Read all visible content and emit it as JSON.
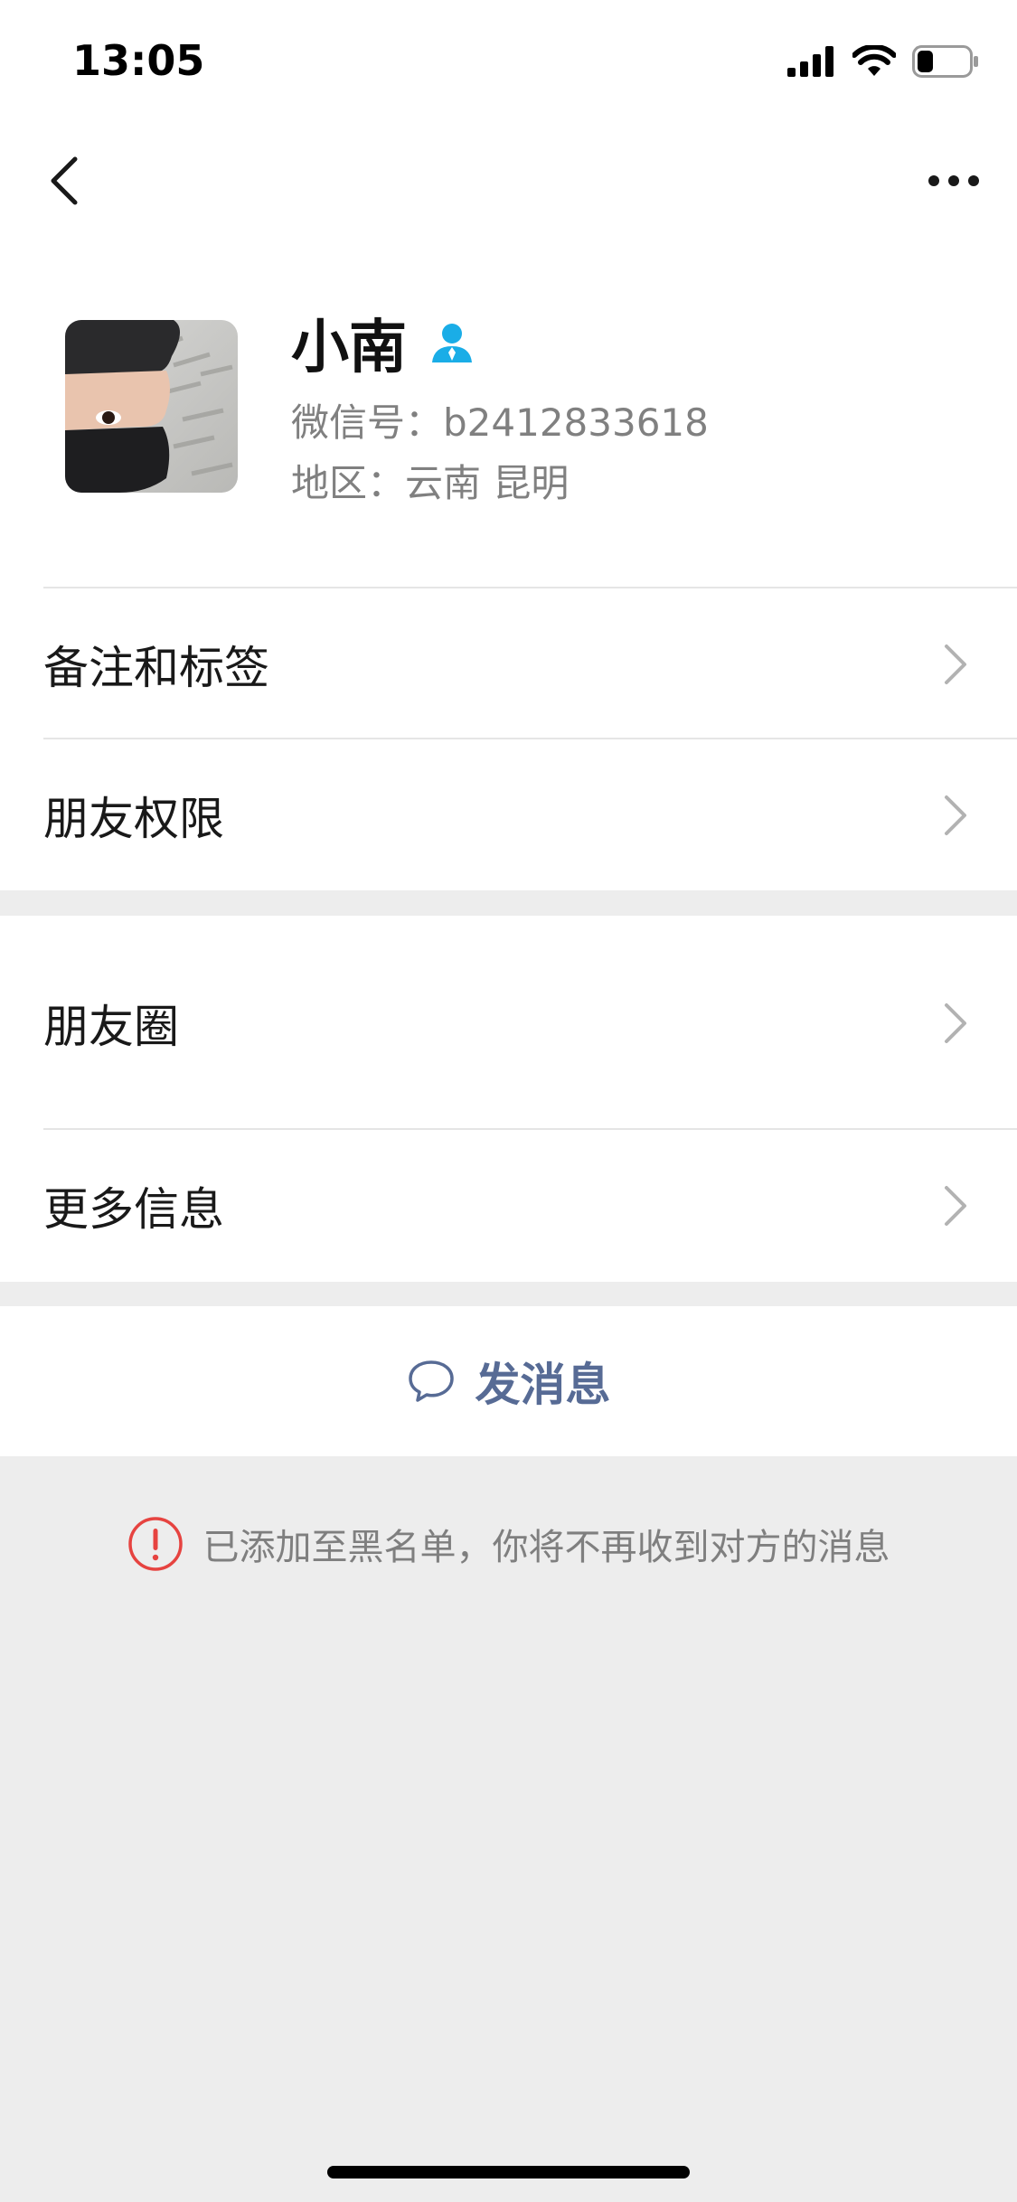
{
  "status_bar": {
    "time": "13:05",
    "icons": [
      "signal-icon",
      "wifi-icon",
      "battery-icon"
    ],
    "battery_level": 0.3
  },
  "nav": {
    "back_icon": "chevron-left-icon",
    "more_icon": "more-dots-icon"
  },
  "profile": {
    "name": "小南",
    "badge_icon": "contact-person-icon",
    "badge_color": "#1aade7",
    "wechat_id_line": "微信号：b2412833618",
    "region_line": "地区：云南 昆明"
  },
  "menu": {
    "remarks_tags": "备注和标签",
    "friend_permissions": "朋友权限",
    "moments": "朋友圈",
    "more_info": "更多信息"
  },
  "actions": {
    "send_message": "发消息",
    "send_message_icon": "chat-bubble-icon",
    "link_color": "#576b95"
  },
  "notice": {
    "icon": "alert-circle-icon",
    "icon_color": "#e64340",
    "text": "已添加至黑名单，你将不再收到对方的消息"
  }
}
